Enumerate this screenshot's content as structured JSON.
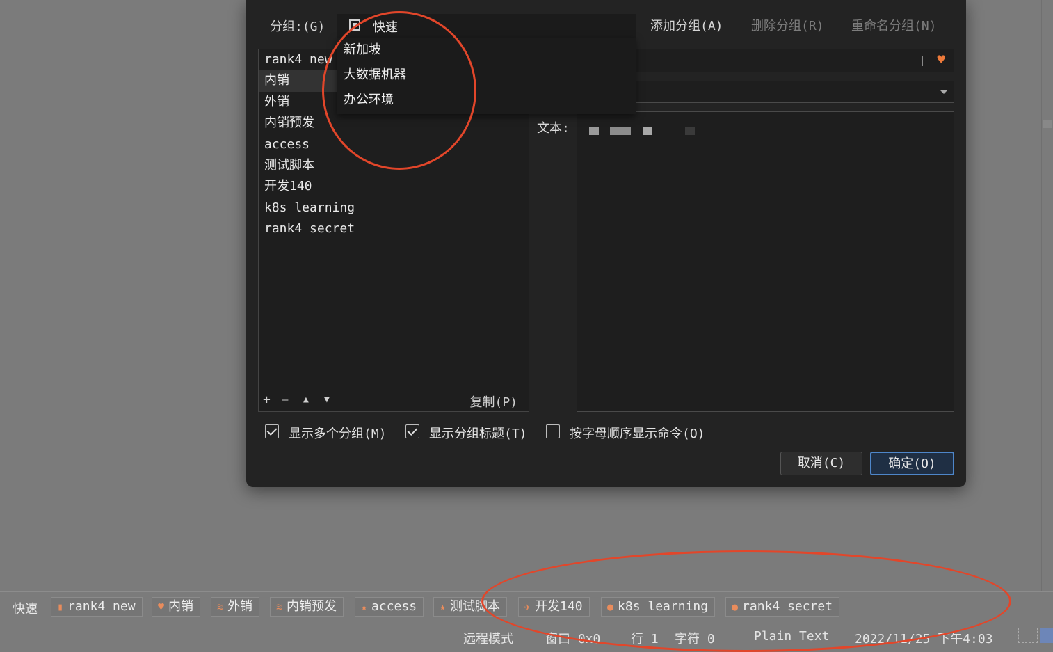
{
  "dialog": {
    "group_label": "分组:(G)",
    "add_group": "添加分组(A)",
    "delete_group": "删除分组(R)",
    "rename_group": "重命名分组(N)",
    "combo_selected": "快速",
    "combo_options": [
      "新加坡",
      "大数据机器",
      "办公环境"
    ],
    "list_items": [
      "rank4 new",
      "内销",
      "外销",
      "内销预发",
      "access",
      "测试脚本",
      "开发140",
      "k8s learning",
      "rank4 secret"
    ],
    "list_bar": {
      "add": "+",
      "remove": "—",
      "up": "▲",
      "down": "▼",
      "copy": "复制(P)"
    },
    "text_label": "文本:",
    "checkboxes": [
      {
        "label": "显示多个分组(M)",
        "checked": true
      },
      {
        "label": "显示分组标题(T)",
        "checked": true
      },
      {
        "label": "按字母顺序显示命令(O)",
        "checked": false
      }
    ],
    "cancel": "取消(C)",
    "ok": "确定(O)"
  },
  "button_bar": {
    "title": "快速",
    "buttons": [
      {
        "label": "rank4 new",
        "icon": "bookmark-icon"
      },
      {
        "label": "内销",
        "icon": "heart-icon"
      },
      {
        "label": "外销",
        "icon": "wifi-icon"
      },
      {
        "label": "内销预发",
        "icon": "wifi-icon"
      },
      {
        "label": "access",
        "icon": "star-icon"
      },
      {
        "label": "测试脚本",
        "icon": "star-icon"
      },
      {
        "label": "开发140",
        "icon": "airplane-icon"
      },
      {
        "label": "k8s learning",
        "icon": "pin-icon"
      },
      {
        "label": "rank4 secret",
        "icon": "pin-icon"
      }
    ]
  },
  "status_bar": {
    "mode": "远程模式",
    "window": "窗口 0x0",
    "line": "行 1",
    "chars": "字符 0",
    "syntax": "Plain Text",
    "datetime": "2022/11/25  下午4:03"
  },
  "colors": {
    "accent": "#4e86c9",
    "icon": "#e98c5c",
    "annotation": "#e2462a"
  }
}
